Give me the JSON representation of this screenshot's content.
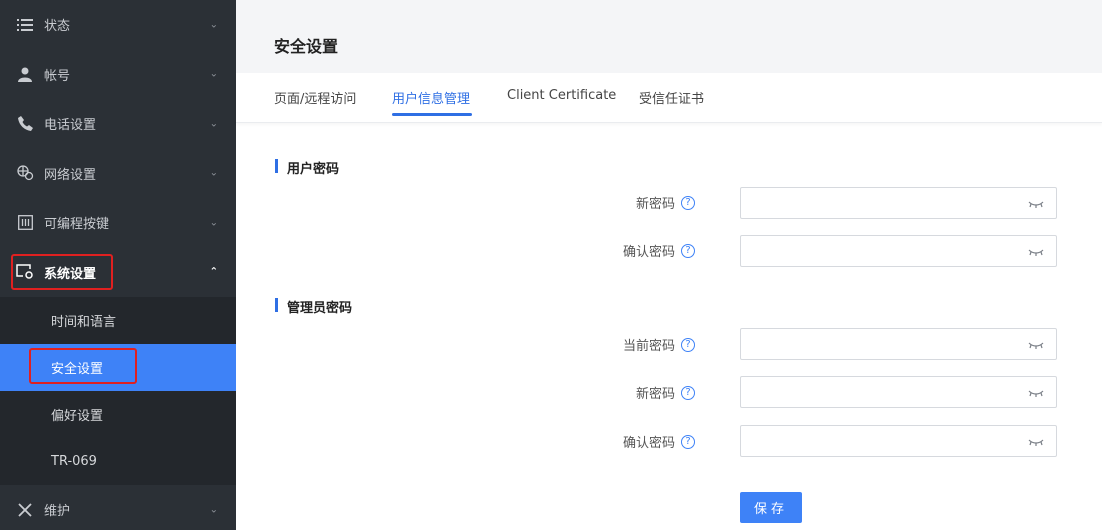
{
  "sidebar": {
    "items": [
      {
        "label": "状态",
        "icon": "list-icon"
      },
      {
        "label": "帐号",
        "icon": "user-icon"
      },
      {
        "label": "电话设置",
        "icon": "phone-icon"
      },
      {
        "label": "网络设置",
        "icon": "network-icon"
      },
      {
        "label": "可编程按键",
        "icon": "keypad-icon"
      },
      {
        "label": "系统设置",
        "icon": "system-settings-icon"
      },
      {
        "label": "维护",
        "icon": "tools-icon"
      }
    ],
    "submenu": [
      {
        "label": "时间和语言"
      },
      {
        "label": "安全设置"
      },
      {
        "label": "偏好设置"
      },
      {
        "label": "TR-069"
      }
    ]
  },
  "header": {
    "title": "安全设置"
  },
  "tabs": [
    {
      "label": "页面/远程访问"
    },
    {
      "label": "用户信息管理"
    },
    {
      "label": "Client Certificate"
    },
    {
      "label": "受信任证书"
    }
  ],
  "sections": {
    "user_password": {
      "title": "用户密码",
      "fields": [
        {
          "label": "新密码"
        },
        {
          "label": "确认密码"
        }
      ]
    },
    "admin_password": {
      "title": "管理员密码",
      "fields": [
        {
          "label": "当前密码"
        },
        {
          "label": "新密码"
        },
        {
          "label": "确认密码"
        }
      ]
    }
  },
  "help_glyph": "?",
  "buttons": {
    "save": "保存"
  },
  "colors": {
    "accent": "#3e82f7",
    "sidebar_bg": "#2b3036",
    "highlight": "#e02020"
  }
}
